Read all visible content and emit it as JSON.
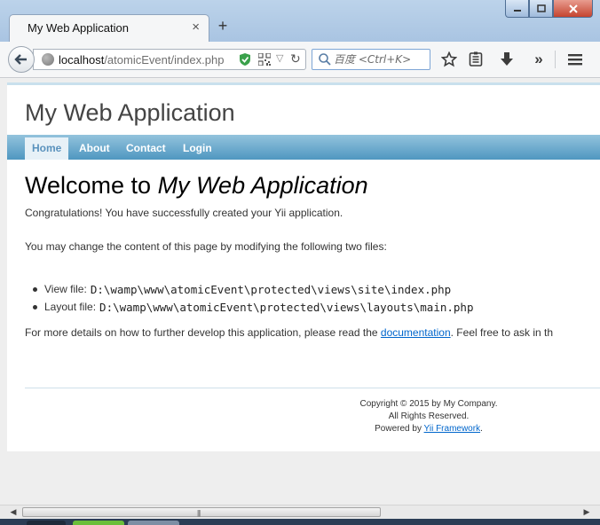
{
  "browser": {
    "tab_title": "My Web Application",
    "tab_close": "×",
    "new_tab": "+",
    "url_host": "localhost",
    "url_path": "/atomicEvent/index.php",
    "search_placeholder": "百度 <Ctrl+K>",
    "icons": [
      "back-icon",
      "globe-icon",
      "shield-icon",
      "qr-code-icon",
      "dropdown-icon",
      "reload-icon",
      "search-icon",
      "bookmark-star-icon",
      "reading-list-icon",
      "download-icon",
      "overflow-chevrons-icon",
      "hamburger-menu-icon"
    ],
    "accent_color": "#4f97c0"
  },
  "site": {
    "title": "My Web Application",
    "menu": [
      {
        "label": "Home",
        "active": true
      },
      {
        "label": "About",
        "active": false
      },
      {
        "label": "Contact",
        "active": false
      },
      {
        "label": "Login",
        "active": false
      }
    ]
  },
  "content": {
    "heading_prefix": "Welcome to ",
    "heading_app": "My Web Application",
    "congrats": "Congratulations! You have successfully created your Yii application.",
    "change_text": "You may change the content of this page by modifying the following two files:",
    "files": [
      {
        "label": "View file:",
        "path": "D:\\wamp\\www\\atomicEvent\\protected\\views\\site\\index.php"
      },
      {
        "label": "Layout file:",
        "path": "D:\\wamp\\www\\atomicEvent\\protected\\views\\layouts\\main.php"
      }
    ],
    "details_before": "For more details on how to further develop this application, please read the ",
    "details_link": "documentation",
    "details_after": ". Feel free to ask in th"
  },
  "footer": {
    "copyright": "Copyright © 2015 by My Company.",
    "rights": "All Rights Reserved.",
    "powered_prefix": "Powered by ",
    "powered_link": "Yii Framework",
    "powered_suffix": "."
  }
}
